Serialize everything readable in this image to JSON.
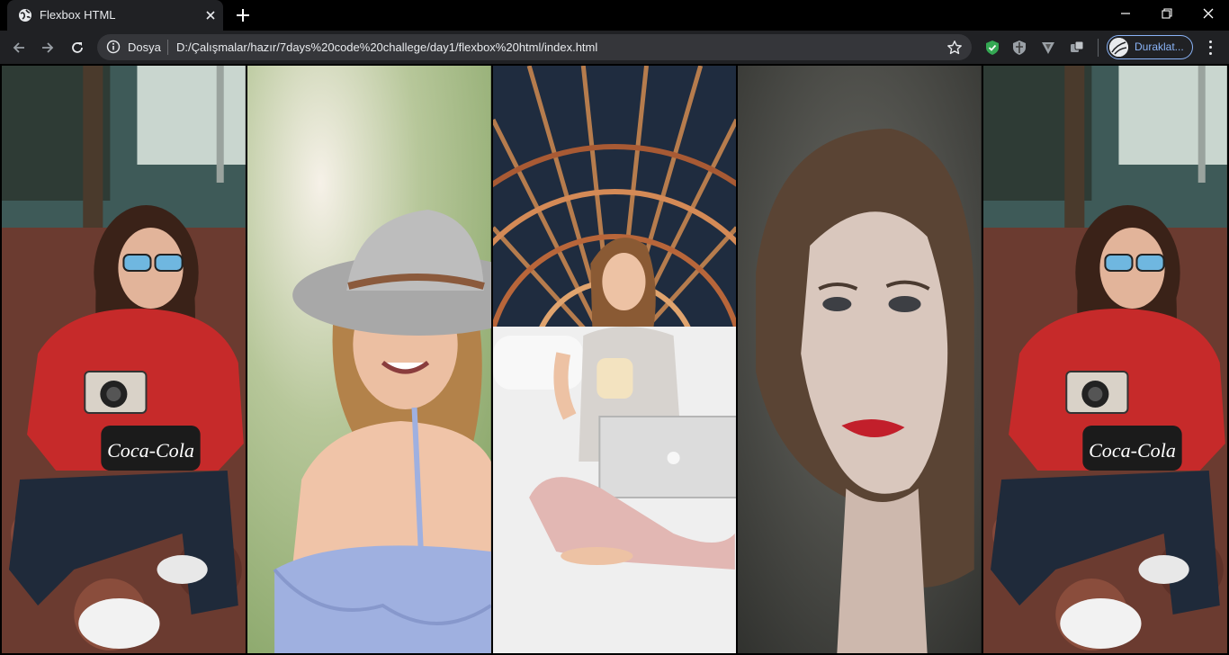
{
  "tab": {
    "title": "Flexbox HTML"
  },
  "address_bar": {
    "scheme_label": "Dosya",
    "url": "D:/Çalışmalar/hazır/7days%20code%20challege/day1/flexbox%20html/index.html"
  },
  "profile": {
    "label": "Duraklat..."
  },
  "colors": {
    "accent": "#8ab4f8",
    "toolbar": "#202124",
    "omnibox": "#35363a",
    "frame": "#000000"
  },
  "gallery": {
    "photos": [
      {
        "subject": "woman-with-camera"
      },
      {
        "subject": "woman-in-hat"
      },
      {
        "subject": "woman-with-laptop"
      },
      {
        "subject": "woman-portrait"
      },
      {
        "subject": "woman-with-camera"
      }
    ]
  }
}
